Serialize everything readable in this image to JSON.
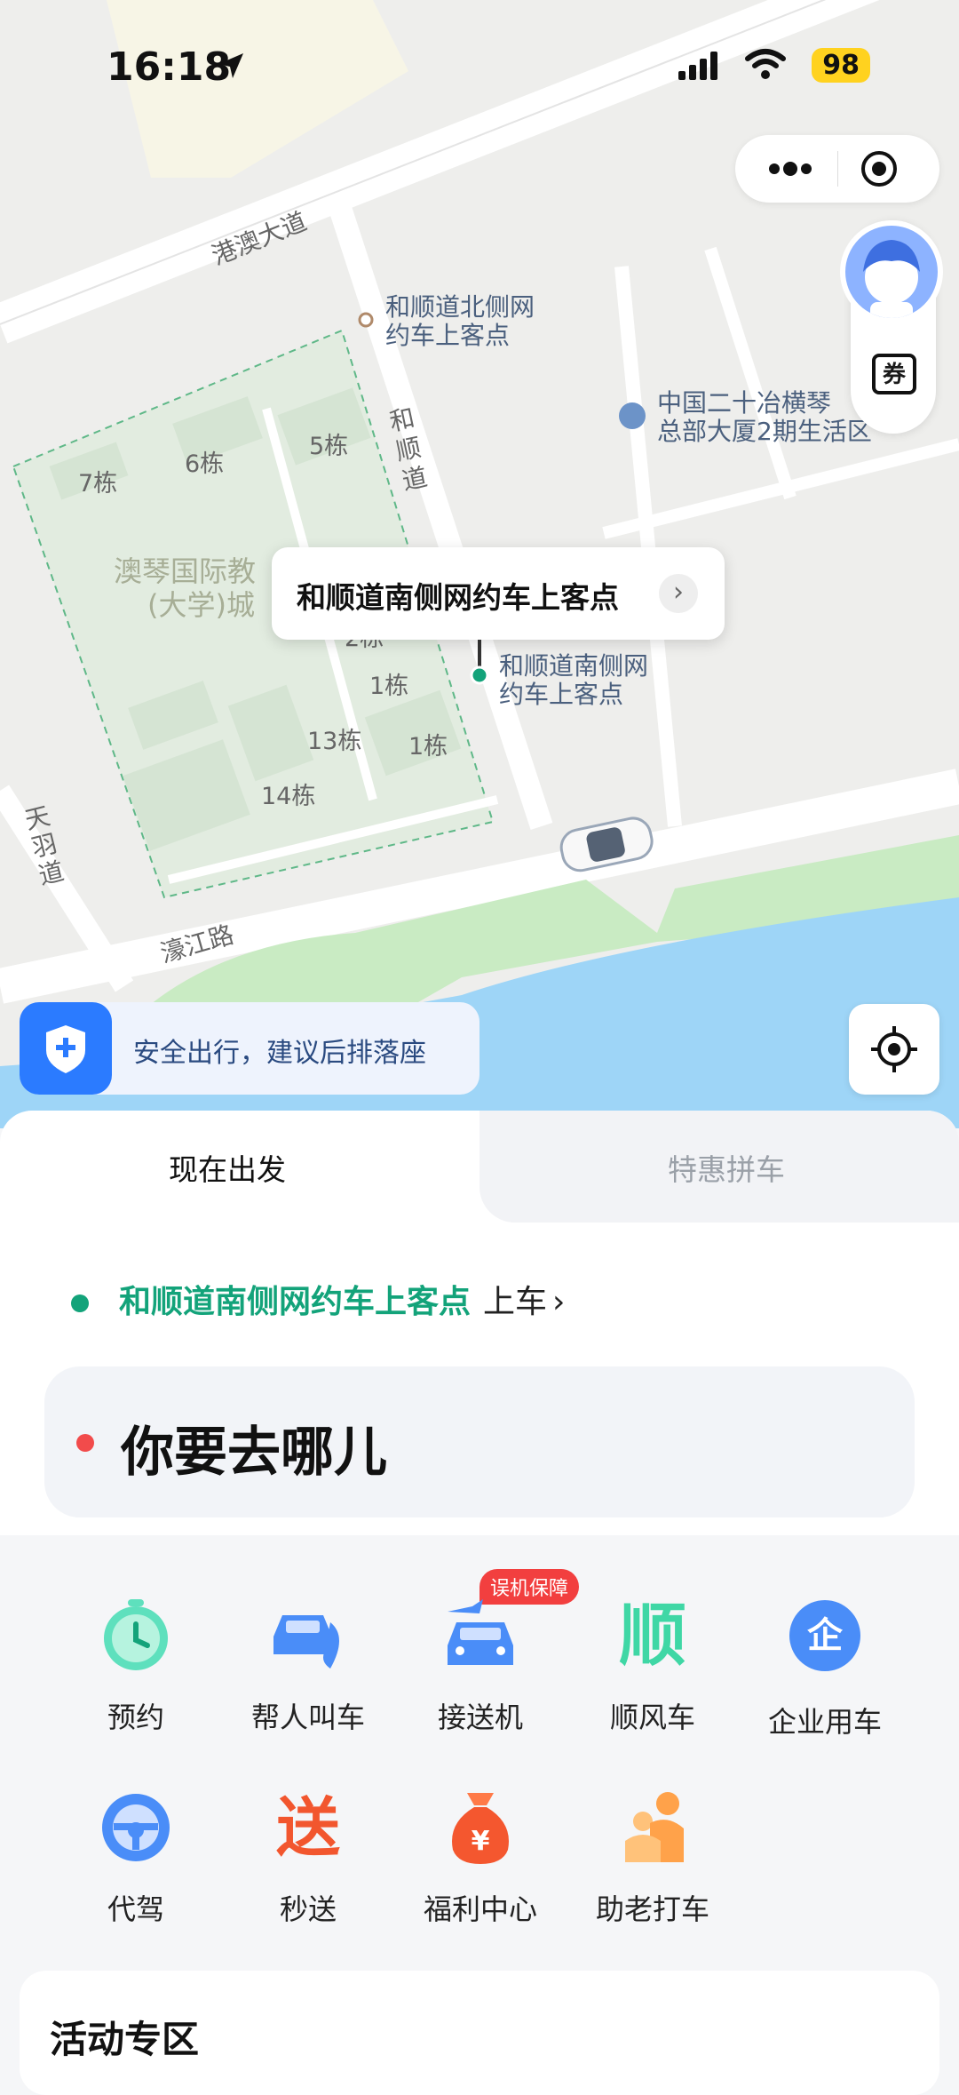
{
  "status_bar": {
    "time": "16:18",
    "battery": "98"
  },
  "map": {
    "labels": {
      "gangao_road": "港澳大道",
      "north_pickup_line1": "和顺道北侧网",
      "north_pickup_line2": "约车上客点",
      "heshun_road": "和顺道",
      "mcc_line1": "中国二十冶横琴",
      "mcc_line2": "总部大厦2期生活区",
      "campus_line1": "澳琴国际教",
      "campus_line2": "(大学)城",
      "b7": "7栋",
      "b6": "6栋",
      "b5": "5栋",
      "b2": "2栋",
      "b1a": "1栋",
      "b1b": "1栋",
      "b13": "13栋",
      "b14": "14栋",
      "south_pickup_line1": "和顺道南侧网",
      "south_pickup_line2": "约车上客点",
      "tianyu_road": "天羽道",
      "haojiang_road": "濠江路"
    },
    "callout": "和顺道南侧网约车上客点",
    "safety_tip": "安全出行，建议后排落座"
  },
  "capsule": {
    "more_icon": "more-icon",
    "close_icon": "target-icon"
  },
  "side": {
    "coupon": "券"
  },
  "tabs": {
    "now": "现在出发",
    "carpool": "特惠拼车"
  },
  "booking": {
    "pickup_place": "和顺道南侧网约车上客点",
    "pickup_suffix": "上车",
    "destination_placeholder": "你要去哪儿"
  },
  "services": {
    "row1": [
      {
        "label": "预约",
        "icon": "clock-icon"
      },
      {
        "label": "帮人叫车",
        "icon": "call-car-icon"
      },
      {
        "label": "接送机",
        "icon": "airport-car-icon"
      },
      {
        "label": "顺风车",
        "icon": "shun-icon"
      },
      {
        "label": "企业用车",
        "icon": "enterprise-icon"
      }
    ],
    "row2": [
      {
        "label": "代驾",
        "icon": "steering-wheel-icon"
      },
      {
        "label": "秒送",
        "icon": "send-icon"
      },
      {
        "label": "福利中心",
        "icon": "money-bag-icon"
      },
      {
        "label": "助老打车",
        "icon": "elderly-icon"
      }
    ],
    "badge": "误机保障",
    "shun_glyph": "顺",
    "send_glyph": "送",
    "enterprise_glyph": "企",
    "money_glyph": "¥"
  },
  "activity": {
    "title": "活动专区"
  },
  "colors": {
    "green": "#13a37a",
    "red": "#f24b4b",
    "blue": "#2b7bff"
  }
}
